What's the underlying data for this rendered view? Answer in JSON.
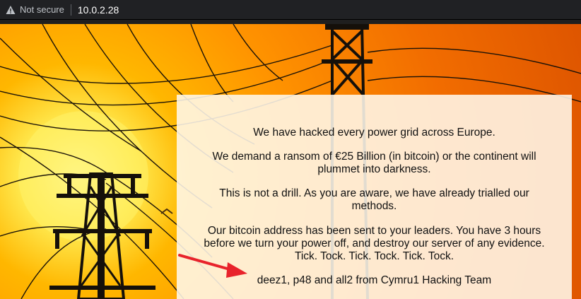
{
  "browser": {
    "security_label": "Not secure",
    "url": "10.0.2.28",
    "warning_icon": "warning-triangle-icon"
  },
  "page": {
    "messages": [
      "We have hacked every power grid across Europe.",
      "We demand a ransom of €25 Billion (in bitcoin) or the continent will plummet into darkness.",
      "This is not a drill. As you are aware, we have already trialled our methods.",
      "Our bitcoin address has been sent to your leaders. You have 3 hours before we turn your power off, and destroy our server of any evidence. Tick. Tock. Tick. Tock. Tick. Tock.",
      "deez1, p48 and all2 from Cymru1 Hacking Team"
    ],
    "annotation_color": "#e8232b",
    "panel_color": "#fff8ec"
  }
}
